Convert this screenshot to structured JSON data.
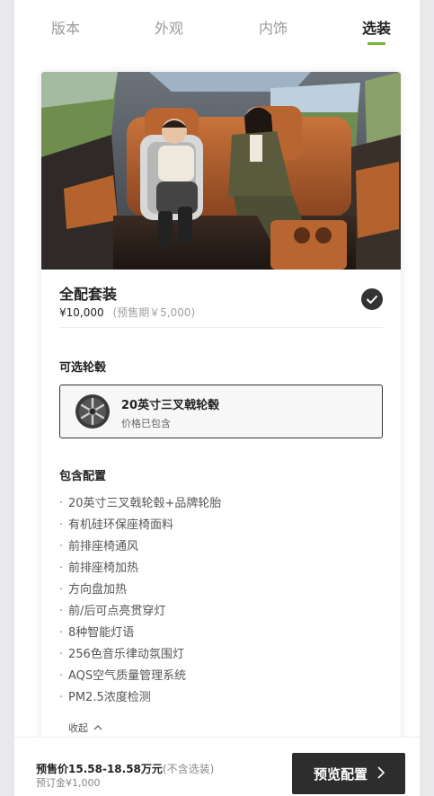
{
  "tabs": [
    {
      "label": "版本",
      "active": false
    },
    {
      "label": "外观",
      "active": false
    },
    {
      "label": "内饰",
      "active": false
    },
    {
      "label": "选装",
      "active": true
    }
  ],
  "colors": {
    "accent": "#7ab23a",
    "dark": "#2d2d2d"
  },
  "package": {
    "title": "全配套装",
    "price": "¥10,000",
    "presale_price": "(预售期￥5,000)",
    "selected": true,
    "icon": "check-icon"
  },
  "wheels": {
    "section_title": "可选轮毂",
    "option_name": "20英寸三叉戟轮毂",
    "option_note": "价格已包含",
    "icon": "wheel-icon"
  },
  "included": {
    "section_title": "包含配置",
    "items": [
      "20英寸三叉戟轮毂+品牌轮胎",
      "有机硅环保座椅面料",
      "前排座椅通风",
      "前排座椅加热",
      "方向盘加热",
      "前/后可点亮贯穿灯",
      "8种智能灯语",
      "256色音乐律动氛围灯",
      "AQS空气质量管理系统",
      "PM2.5浓度检测"
    ],
    "collapse_label": "收起"
  },
  "bottom": {
    "presale_label": "预售价",
    "presale_value": "15.58-18.58万元",
    "presale_note": "(不含选装)",
    "deposit": "预订金¥1,000",
    "preview_button": "预览配置"
  }
}
